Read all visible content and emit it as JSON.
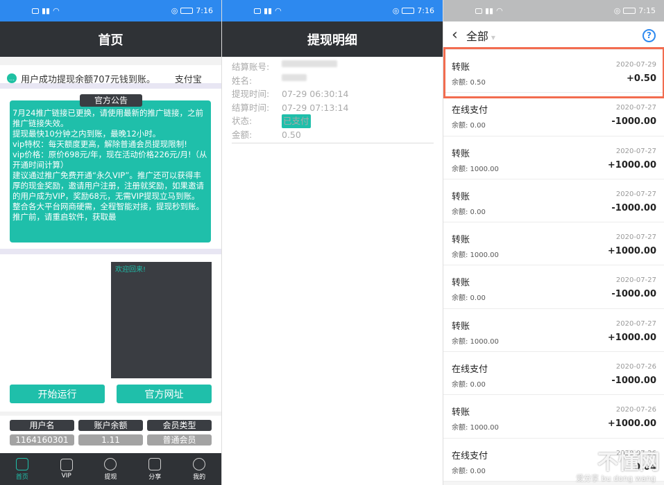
{
  "status_bar": {
    "panel1_time": "7:16",
    "panel2_time": "7:16",
    "panel3_time": "7:15"
  },
  "panel1": {
    "title": "首页",
    "marquee_text": "用户成功提现余额707元钱到账。",
    "marquee_extra": "支付宝",
    "notice_title": "官方公告",
    "notice_text": "7月24推广链接已更换，请使用最新的推广链接，之前推广链接失效。\n提现最快10分钟之内到账，最晚12小时。\nvip特权：每天额度更高，解除普通会员提现限制!\nvip价格：原价698元/年，现在活动价格226元/月!（从开通时间计算）\n建议通过推广免费开通“永久VIP”。推广还可以获得丰厚的现金奖励，邀请用户注册，注册就奖励，如果邀请的用户成为VIP，奖励68元，无需VIP提现立马到账。\n整合各大平台网商硬需，全程智能对接，提现秒到账。\n推广前，请重启软件，获取最",
    "console_text": "欢迎回来!",
    "btn_start": "开始运行",
    "btn_site": "官方网址",
    "info": {
      "h_username": "用户名",
      "h_balance": "账户余额",
      "h_type": "会员类型",
      "v_username": "1164160301",
      "v_balance": "1.11",
      "v_type": "普通会员"
    },
    "tabs": [
      {
        "label": "首页",
        "icon": "home-icon"
      },
      {
        "label": "VIP",
        "icon": "crown-icon"
      },
      {
        "label": "提现",
        "icon": "yuan-icon"
      },
      {
        "label": "分享",
        "icon": "link-icon"
      },
      {
        "label": "我的",
        "icon": "user-icon"
      }
    ]
  },
  "panel2": {
    "title": "提现明细",
    "rows": [
      {
        "label": "结算账号:",
        "value": ""
      },
      {
        "label": "姓名:",
        "value": ""
      },
      {
        "label": "提现时间:",
        "value": "07-29 06:30:14"
      },
      {
        "label": "结算时间:",
        "value": "07-29 07:13:14"
      },
      {
        "label": "状态:",
        "value": "已支付"
      },
      {
        "label": "金额:",
        "value": "0.50"
      }
    ]
  },
  "panel3": {
    "title": "全部",
    "help_label": "?",
    "transactions": [
      {
        "type": "转账",
        "balance": "余额: 0.50",
        "date": "2020-07-29",
        "amount": "+0.50"
      },
      {
        "type": "在线支付",
        "balance": "余额: 0.00",
        "date": "2020-07-27",
        "amount": "-1000.00"
      },
      {
        "type": "转账",
        "balance": "余额: 1000.00",
        "date": "2020-07-27",
        "amount": "+1000.00"
      },
      {
        "type": "转账",
        "balance": "余额: 0.00",
        "date": "2020-07-27",
        "amount": "-1000.00"
      },
      {
        "type": "转账",
        "balance": "余额: 1000.00",
        "date": "2020-07-27",
        "amount": "+1000.00"
      },
      {
        "type": "转账",
        "balance": "余额: 0.00",
        "date": "2020-07-27",
        "amount": "-1000.00"
      },
      {
        "type": "转账",
        "balance": "余额: 1000.00",
        "date": "2020-07-27",
        "amount": "+1000.00"
      },
      {
        "type": "在线支付",
        "balance": "余额: 0.00",
        "date": "2020-07-26",
        "amount": "-1000.00"
      },
      {
        "type": "转账",
        "balance": "余额: 1000.00",
        "date": "2020-07-26",
        "amount": "+1000.00"
      },
      {
        "type": "在线支付",
        "balance": "余额: 0.00",
        "date": "2020-07-26",
        "amount": "-0.04"
      }
    ]
  },
  "watermark": {
    "main": "不懂网",
    "sub": "爱分享 bu dong wang"
  },
  "colors": {
    "accent": "#1fbfaa",
    "statusbar_blue": "#2d89ef",
    "titlebar_dark": "#2f3236",
    "highlight": "#f26c4f"
  }
}
